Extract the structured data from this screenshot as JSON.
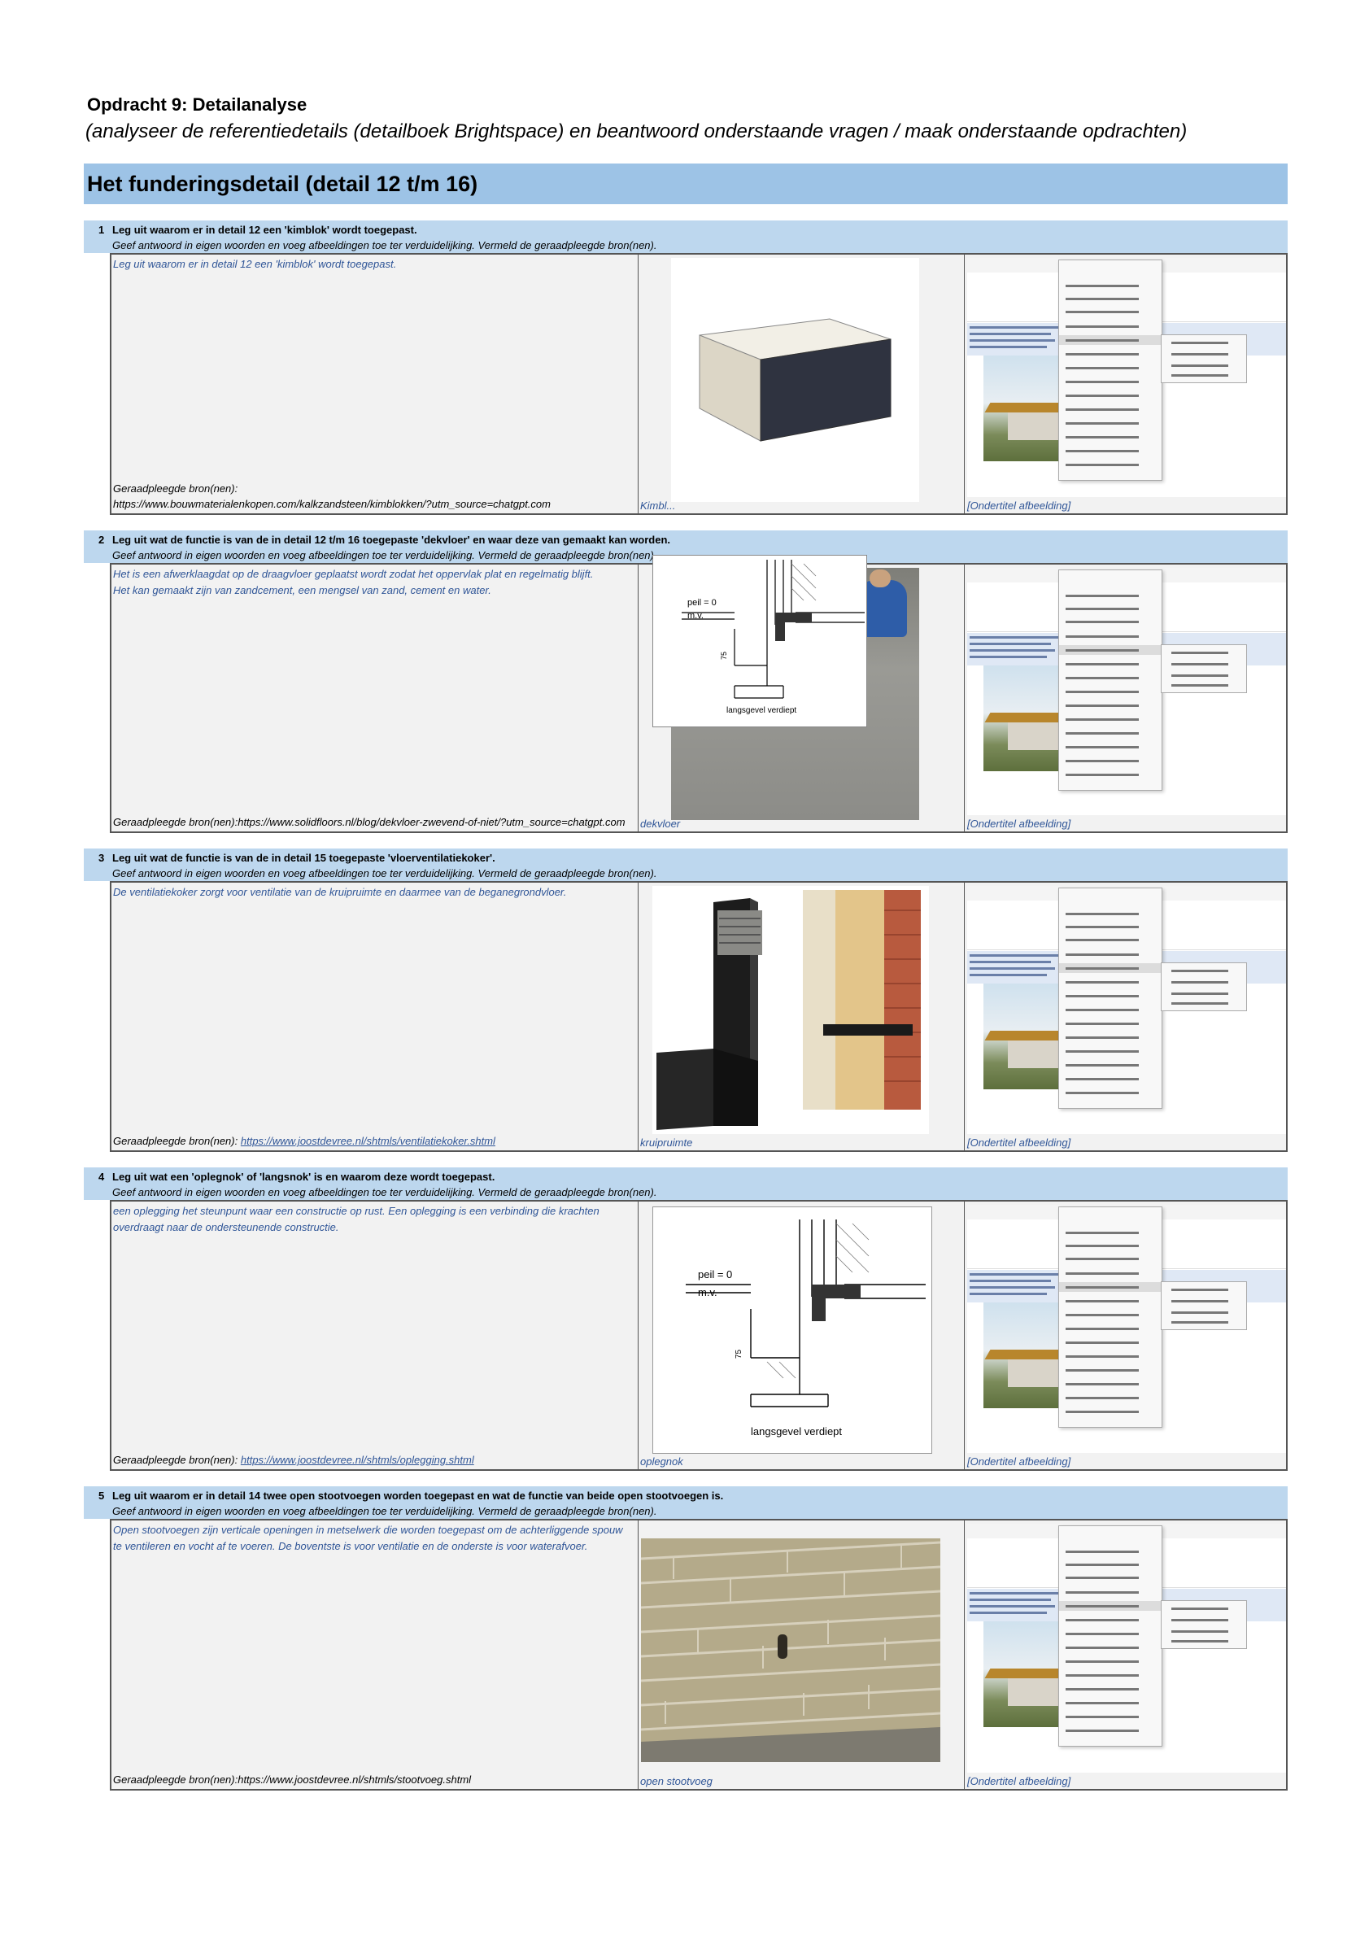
{
  "header": {
    "title": "Opdracht 9: Detailanalyse",
    "subtitle": "(analyseer de referentiedetails (detailboek Brightspace) en beantwoord onderstaande vragen / maak onderstaande opdrachten)"
  },
  "section_title": "Het funderingsdetail (detail 12 t/m 16)",
  "instruction": "Geef antwoord in eigen woorden en voeg afbeeldingen toe ter verduidelijking. Vermeld de geraadpleegde bron(nen).",
  "questions": [
    {
      "number": "1",
      "question": "Leg uit waarom er in detail 12 een 'kimblok' wordt toegepast.",
      "answer": "Leg uit waarom er in detail 12 een 'kimblok' wordt toegepast.",
      "source_label": "Geraadpleegde bron(nen):",
      "source_url": "https://www.bouwmaterialenkopen.com/kalkzandsteen/kimblokken/?utm_source=chatgpt.com",
      "image_caption": "Kimbl...",
      "shot_caption": "[Ondertitel afbeelding]"
    },
    {
      "number": "2",
      "question": "Leg uit wat de functie is van de in detail 12 t/m 16 toegepaste 'dekvloer' en waar deze van gemaakt kan worden.",
      "answer": "Het is een afwerklaagdat op de draagvloer geplaatst wordt zodat het oppervlak plat en regelmatig blijft.\nHet kan gemaakt zijn van zandcement, een mengsel van zand, cement en water.",
      "source_label": "Geraadpleegde bron(nen):https://www.solidfloors.nl/blog/dekvloer-zwevend-of-niet/?utm_source=chatgpt.com",
      "source_url": "",
      "image_caption": "dekvloer",
      "shot_caption": "[Ondertitel afbeelding]",
      "drawing_labels": [
        "peil = 0",
        "m.v.",
        "75",
        "langsgevel verdiept"
      ]
    },
    {
      "number": "3",
      "question": "Leg uit wat de functie is van de in detail 15 toegepaste 'vloerventilatiekoker'.",
      "answer": "De ventilatiekoker zorgt voor ventilatie van de kruipruimte en daarmee van de beganegrondvloer.",
      "source_label": "Geraadpleegde bron(nen):",
      "source_url": "https://www.joostdevree.nl/shtmls/ventilatiekoker.shtml",
      "image_caption": "kruipruimte",
      "shot_caption": "[Ondertitel afbeelding]"
    },
    {
      "number": "4",
      "question": "Leg uit wat een 'oplegnok' of 'langsnok' is en waarom deze wordt toegepast.",
      "answer": "een oplegging het steunpunt waar een constructie op rust. Een oplegging is een verbinding die krachten overdraagt naar de ondersteunende constructie.",
      "source_label": "Geraadpleegde bron(nen):",
      "source_url": "https://www.joostdevree.nl/shtmls/oplegging.shtml",
      "image_caption": "oplegnok",
      "shot_caption": "[Ondertitel afbeelding]",
      "drawing_labels": [
        "peil = 0",
        "m.v.",
        "75",
        "langsgevel verdiept"
      ]
    },
    {
      "number": "5",
      "question": "Leg uit waarom er in detail 14 twee open stootvoegen worden toegepast en wat de functie van beide open stootvoegen is.",
      "answer": "Open stootvoegen zijn verticale openingen in metselwerk die worden toegepast om de achterliggende spouw te ventileren en vocht af te voeren. De boventste is voor ventilatie en de onderste is voor waterafvoer.",
      "source_label": "Geraadpleegde bron(nen):https://www.joostdevree.nl/shtmls/stootvoeg.shtml",
      "source_url": "",
      "image_caption": "open stootvoeg",
      "shot_caption": "[Ondertitel afbeelding]"
    }
  ]
}
